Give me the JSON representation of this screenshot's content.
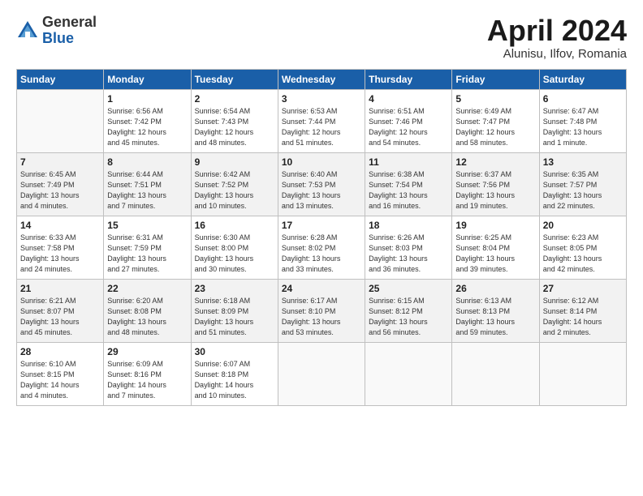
{
  "header": {
    "logo_general": "General",
    "logo_blue": "Blue",
    "title": "April 2024",
    "subtitle": "Alunisu, Ilfov, Romania"
  },
  "days_of_week": [
    "Sunday",
    "Monday",
    "Tuesday",
    "Wednesday",
    "Thursday",
    "Friday",
    "Saturday"
  ],
  "weeks": [
    [
      {
        "day": "",
        "info": ""
      },
      {
        "day": "1",
        "info": "Sunrise: 6:56 AM\nSunset: 7:42 PM\nDaylight: 12 hours\nand 45 minutes."
      },
      {
        "day": "2",
        "info": "Sunrise: 6:54 AM\nSunset: 7:43 PM\nDaylight: 12 hours\nand 48 minutes."
      },
      {
        "day": "3",
        "info": "Sunrise: 6:53 AM\nSunset: 7:44 PM\nDaylight: 12 hours\nand 51 minutes."
      },
      {
        "day": "4",
        "info": "Sunrise: 6:51 AM\nSunset: 7:46 PM\nDaylight: 12 hours\nand 54 minutes."
      },
      {
        "day": "5",
        "info": "Sunrise: 6:49 AM\nSunset: 7:47 PM\nDaylight: 12 hours\nand 58 minutes."
      },
      {
        "day": "6",
        "info": "Sunrise: 6:47 AM\nSunset: 7:48 PM\nDaylight: 13 hours\nand 1 minute."
      }
    ],
    [
      {
        "day": "7",
        "info": "Sunrise: 6:45 AM\nSunset: 7:49 PM\nDaylight: 13 hours\nand 4 minutes."
      },
      {
        "day": "8",
        "info": "Sunrise: 6:44 AM\nSunset: 7:51 PM\nDaylight: 13 hours\nand 7 minutes."
      },
      {
        "day": "9",
        "info": "Sunrise: 6:42 AM\nSunset: 7:52 PM\nDaylight: 13 hours\nand 10 minutes."
      },
      {
        "day": "10",
        "info": "Sunrise: 6:40 AM\nSunset: 7:53 PM\nDaylight: 13 hours\nand 13 minutes."
      },
      {
        "day": "11",
        "info": "Sunrise: 6:38 AM\nSunset: 7:54 PM\nDaylight: 13 hours\nand 16 minutes."
      },
      {
        "day": "12",
        "info": "Sunrise: 6:37 AM\nSunset: 7:56 PM\nDaylight: 13 hours\nand 19 minutes."
      },
      {
        "day": "13",
        "info": "Sunrise: 6:35 AM\nSunset: 7:57 PM\nDaylight: 13 hours\nand 22 minutes."
      }
    ],
    [
      {
        "day": "14",
        "info": "Sunrise: 6:33 AM\nSunset: 7:58 PM\nDaylight: 13 hours\nand 24 minutes."
      },
      {
        "day": "15",
        "info": "Sunrise: 6:31 AM\nSunset: 7:59 PM\nDaylight: 13 hours\nand 27 minutes."
      },
      {
        "day": "16",
        "info": "Sunrise: 6:30 AM\nSunset: 8:00 PM\nDaylight: 13 hours\nand 30 minutes."
      },
      {
        "day": "17",
        "info": "Sunrise: 6:28 AM\nSunset: 8:02 PM\nDaylight: 13 hours\nand 33 minutes."
      },
      {
        "day": "18",
        "info": "Sunrise: 6:26 AM\nSunset: 8:03 PM\nDaylight: 13 hours\nand 36 minutes."
      },
      {
        "day": "19",
        "info": "Sunrise: 6:25 AM\nSunset: 8:04 PM\nDaylight: 13 hours\nand 39 minutes."
      },
      {
        "day": "20",
        "info": "Sunrise: 6:23 AM\nSunset: 8:05 PM\nDaylight: 13 hours\nand 42 minutes."
      }
    ],
    [
      {
        "day": "21",
        "info": "Sunrise: 6:21 AM\nSunset: 8:07 PM\nDaylight: 13 hours\nand 45 minutes."
      },
      {
        "day": "22",
        "info": "Sunrise: 6:20 AM\nSunset: 8:08 PM\nDaylight: 13 hours\nand 48 minutes."
      },
      {
        "day": "23",
        "info": "Sunrise: 6:18 AM\nSunset: 8:09 PM\nDaylight: 13 hours\nand 51 minutes."
      },
      {
        "day": "24",
        "info": "Sunrise: 6:17 AM\nSunset: 8:10 PM\nDaylight: 13 hours\nand 53 minutes."
      },
      {
        "day": "25",
        "info": "Sunrise: 6:15 AM\nSunset: 8:12 PM\nDaylight: 13 hours\nand 56 minutes."
      },
      {
        "day": "26",
        "info": "Sunrise: 6:13 AM\nSunset: 8:13 PM\nDaylight: 13 hours\nand 59 minutes."
      },
      {
        "day": "27",
        "info": "Sunrise: 6:12 AM\nSunset: 8:14 PM\nDaylight: 14 hours\nand 2 minutes."
      }
    ],
    [
      {
        "day": "28",
        "info": "Sunrise: 6:10 AM\nSunset: 8:15 PM\nDaylight: 14 hours\nand 4 minutes."
      },
      {
        "day": "29",
        "info": "Sunrise: 6:09 AM\nSunset: 8:16 PM\nDaylight: 14 hours\nand 7 minutes."
      },
      {
        "day": "30",
        "info": "Sunrise: 6:07 AM\nSunset: 8:18 PM\nDaylight: 14 hours\nand 10 minutes."
      },
      {
        "day": "",
        "info": ""
      },
      {
        "day": "",
        "info": ""
      },
      {
        "day": "",
        "info": ""
      },
      {
        "day": "",
        "info": ""
      }
    ]
  ]
}
